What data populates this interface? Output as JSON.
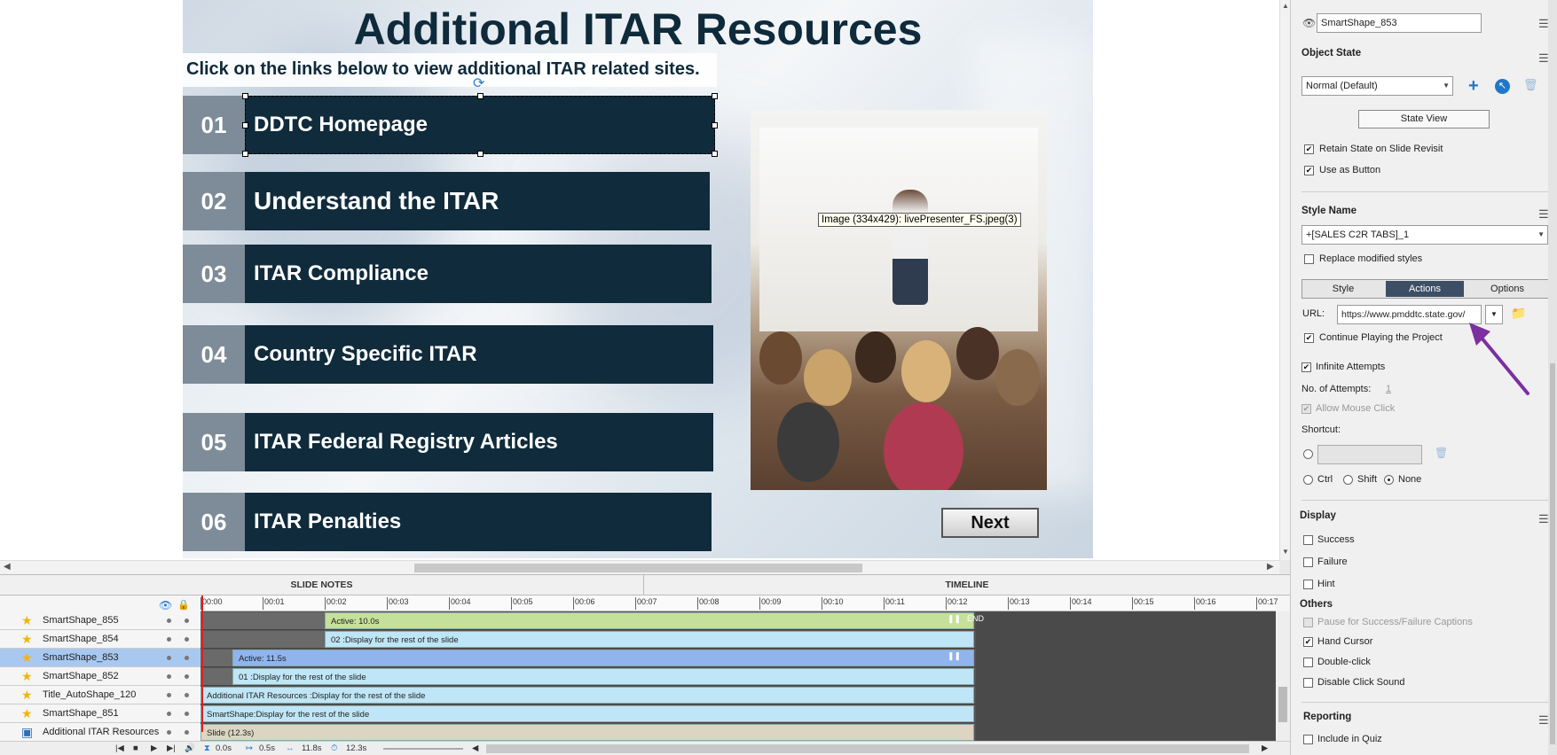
{
  "slide": {
    "title": "Additional ITAR Resources",
    "subtitle": "Click on the links below to view additional ITAR related sites.",
    "rows": [
      {
        "num": "01",
        "label": "DDTC Homepage"
      },
      {
        "num": "02",
        "label": "Understand the ITAR"
      },
      {
        "num": "03",
        "label": "ITAR Compliance"
      },
      {
        "num": "04",
        "label": "Country Specific ITAR"
      },
      {
        "num": "05",
        "label": "ITAR Federal Registry Articles"
      },
      {
        "num": "06",
        "label": "ITAR Penalties"
      }
    ],
    "image_tooltip": "Image (334x429): livePresenter_FS.jpeg(3)",
    "next_label": "Next"
  },
  "bottom_tabs": {
    "notes": "SLIDE NOTES",
    "timeline": "TIMELINE"
  },
  "timeline": {
    "ticks": [
      "00:00",
      "00:01",
      "00:02",
      "00:03",
      "00:04",
      "00:05",
      "00:06",
      "00:07",
      "00:08",
      "00:09",
      "00:10",
      "00:11",
      "00:12",
      "00:13",
      "00:14",
      "00:15",
      "00:16",
      "00:17"
    ],
    "end_label": "END",
    "layers": [
      {
        "name": "SmartShape_855",
        "bar": "Active: 10.0s"
      },
      {
        "name": "SmartShape_854",
        "bar": "02 :Display for the rest of the slide"
      },
      {
        "name": "SmartShape_853",
        "bar": "Active: 11.5s"
      },
      {
        "name": "SmartShape_852",
        "bar": "01 :Display for the rest of the slide"
      },
      {
        "name": "Title_AutoShape_120",
        "bar": "Additional ITAR Resources :Display for the rest of the slide"
      },
      {
        "name": "SmartShape_851",
        "bar": "SmartShape:Display for the rest of the slide"
      },
      {
        "name": "Additional ITAR Resources",
        "bar": "Slide (12.3s)"
      }
    ],
    "footer": {
      "t1": "0.0s",
      "t2": "0.5s",
      "t3": "11.8s",
      "t4": "12.3s"
    }
  },
  "panel": {
    "object_name": "SmartShape_853",
    "object_state_title": "Object State",
    "state_value": "Normal (Default)",
    "state_view_label": "State View",
    "retain_state_label": "Retain State on Slide Revisit",
    "use_as_button_label": "Use as Button",
    "style_name_title": "Style Name",
    "style_value": "+[SALES C2R TABS]_1",
    "replace_styles_label": "Replace modified styles",
    "tabs": {
      "style": "Style",
      "actions": "Actions",
      "options": "Options"
    },
    "url_label": "URL:",
    "url_value": "https://www.pmddtc.state.gov/",
    "continue_playing_label": "Continue Playing the Project",
    "infinite_attempts_label": "Infinite Attempts",
    "attempts_label": "No. of Attempts:",
    "attempts_value": "1",
    "allow_mouse_label": "Allow Mouse Click",
    "shortcut_label": "Shortcut:",
    "ctrl_label": "Ctrl",
    "shift_label": "Shift",
    "none_label": "None",
    "display_title": "Display",
    "success_label": "Success",
    "failure_label": "Failure",
    "hint_label": "Hint",
    "others_title": "Others",
    "pause_label": "Pause for Success/Failure Captions",
    "hand_cursor_label": "Hand Cursor",
    "double_click_label": "Double-click",
    "disable_sound_label": "Disable Click Sound",
    "reporting_title": "Reporting",
    "include_quiz_label": "Include in Quiz"
  },
  "colors": {
    "row_bar": "#102b3b",
    "row_num": "#7e8c99",
    "actions_tab": "#3d4f66",
    "annotation_arrow": "#7b2fa0"
  }
}
